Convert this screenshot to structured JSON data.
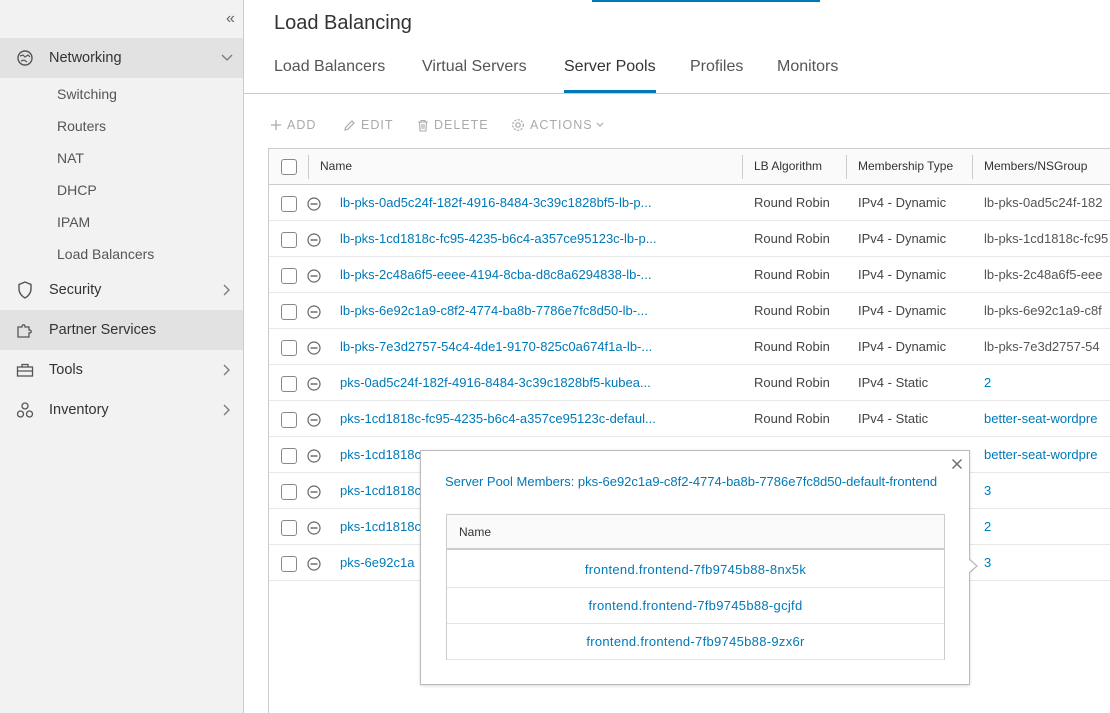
{
  "sidebar": {
    "collapse_label": "«",
    "items": [
      {
        "label": "Networking",
        "icon": "networking-icon",
        "expanded": true
      },
      {
        "label": "Security",
        "icon": "shield-icon"
      },
      {
        "label": "Partner Services",
        "icon": "puzzle-icon"
      },
      {
        "label": "Tools",
        "icon": "toolbox-icon"
      },
      {
        "label": "Inventory",
        "icon": "inventory-icon"
      }
    ],
    "networking_sub": [
      "Switching",
      "Routers",
      "NAT",
      "DHCP",
      "IPAM",
      "Load Balancers"
    ]
  },
  "page": {
    "title": "Load Balancing",
    "tabs": [
      "Load Balancers",
      "Virtual Servers",
      "Server Pools",
      "Profiles",
      "Monitors"
    ],
    "active_tab": "Server Pools"
  },
  "toolbar": {
    "add": "ADD",
    "edit": "EDIT",
    "delete": "DELETE",
    "actions": "ACTIONS"
  },
  "table": {
    "columns": [
      "Name",
      "LB Algorithm",
      "Membership Type",
      "Members/NSGroup"
    ],
    "rows": [
      {
        "name": "lb-pks-0ad5c24f-182f-4916-8484-3c39c1828bf5-lb-p...",
        "algo": "Round Robin",
        "mtype": "IPv4 - Dynamic",
        "members": "lb-pks-0ad5c24f-182",
        "link": false
      },
      {
        "name": "lb-pks-1cd1818c-fc95-4235-b6c4-a357ce95123c-lb-p...",
        "algo": "Round Robin",
        "mtype": "IPv4 - Dynamic",
        "members": "lb-pks-1cd1818c-fc95",
        "link": false
      },
      {
        "name": "lb-pks-2c48a6f5-eeee-4194-8cba-d8c8a6294838-lb-...",
        "algo": "Round Robin",
        "mtype": "IPv4 - Dynamic",
        "members": "lb-pks-2c48a6f5-eee",
        "link": false
      },
      {
        "name": "lb-pks-6e92c1a9-c8f2-4774-ba8b-7786e7fc8d50-lb-...",
        "algo": "Round Robin",
        "mtype": "IPv4 - Dynamic",
        "members": "lb-pks-6e92c1a9-c8f",
        "link": false
      },
      {
        "name": "lb-pks-7e3d2757-54c4-4de1-9170-825c0a674f1a-lb-...",
        "algo": "Round Robin",
        "mtype": "IPv4 - Dynamic",
        "members": "lb-pks-7e3d2757-54",
        "link": false
      },
      {
        "name": "pks-0ad5c24f-182f-4916-8484-3c39c1828bf5-kubea...",
        "algo": "Round Robin",
        "mtype": "IPv4 - Static",
        "members": "2",
        "link": true
      },
      {
        "name": "pks-1cd1818c-fc95-4235-b6c4-a357ce95123c-defaul...",
        "algo": "Round Robin",
        "mtype": "IPv4 - Static",
        "members": "better-seat-wordpre",
        "link": true
      },
      {
        "name": "pks-1cd1818c",
        "algo": "",
        "mtype": "",
        "members": "better-seat-wordpre",
        "link": true
      },
      {
        "name": "pks-1cd1818c",
        "algo": "",
        "mtype": "",
        "members": "3",
        "link": true
      },
      {
        "name": "pks-1cd1818c",
        "algo": "",
        "mtype": "",
        "members": "2",
        "link": true
      },
      {
        "name": "pks-6e92c1a",
        "algo": "",
        "mtype": "",
        "members": "3",
        "link": true
      }
    ]
  },
  "popover": {
    "title": "Server Pool Members: pks-6e92c1a9-c8f2-4774-ba8b-7786e7fc8d50-default-frontend",
    "column": "Name",
    "members": [
      "frontend.frontend-7fb9745b88-8nx5k",
      "frontend.frontend-7fb9745b88-gcjfd",
      "frontend.frontend-7fb9745b88-9zx6r"
    ]
  },
  "colors": {
    "accent": "#0079b8",
    "sidebar_bg": "#f2f2f2",
    "disabled": "#aaaaaa"
  }
}
